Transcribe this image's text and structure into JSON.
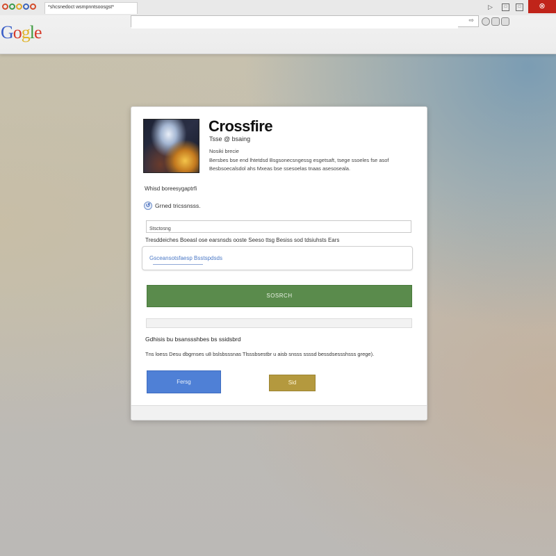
{
  "browser": {
    "tab_title": "*shcsnedoct wsmpnntsoosgst*",
    "address_value": "",
    "logo_text": [
      "G",
      "o",
      "g",
      "l",
      "e"
    ],
    "close_label": "⊗"
  },
  "colors": {
    "search_button": "#5a8b4c",
    "primary_button": "#4f80d6",
    "secondary_button": "#b4993e",
    "close_button": "#c0241a"
  },
  "dialog": {
    "title": "Crossfire",
    "subtitle": "Tsse @ bsaing",
    "meta": "Nosiki brecie",
    "description_line1": "Bersbes bse end lhtetdsd Bsgsonecsngessg esgetsaft, tsege ssoeles fse asof",
    "description_line2": "Besbsoecalsdol ahs Mxeas bse ssesoelas tnaas asesoseala.",
    "section_label": "Whisd boreesygaptrfi",
    "radio_label": "Grned tricssnsss.",
    "field1_value": "Stsctosng",
    "help_text": "Tresddeiches Boeasl ose earsnsds ooste Seeso ttsg Besiss sod tdsiuhsts Ears",
    "field2_value": "Gsceansotsfaesp Bsstspdsds",
    "search_label": "SOSRCH",
    "progress": 0.0,
    "results_heading": "Gdhisis bu bsanssshbes bs ssidsbrd",
    "note": "Tns loess Desu dbgrnses u8 bslsbsssnas Tlsssbsestbr u aisb snsss ssssd bessdsessshsss grege).",
    "primary_button": "Fersg",
    "secondary_button": "Sid"
  }
}
